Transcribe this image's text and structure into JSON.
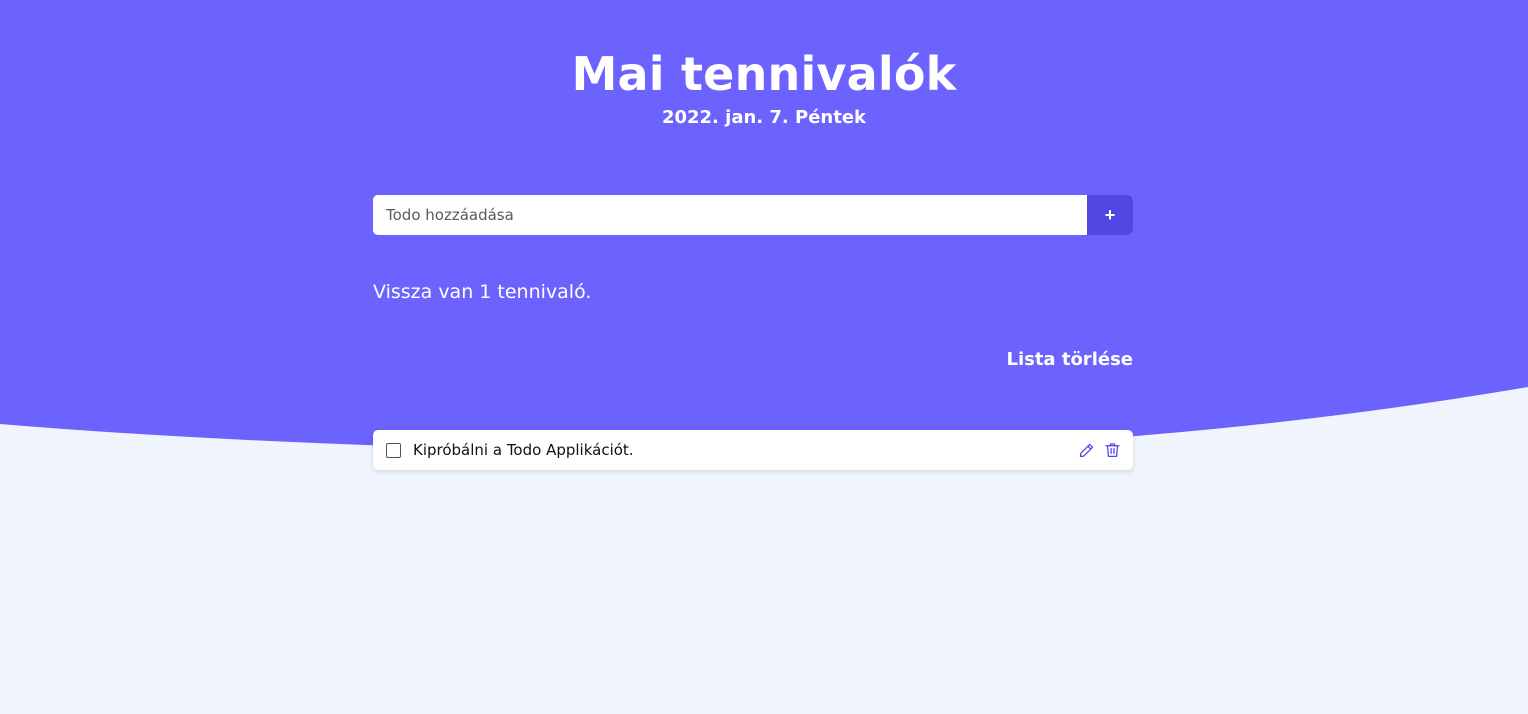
{
  "header": {
    "title": "Mai tennivalók",
    "date": "2022. jan. 7. Péntek"
  },
  "add_form": {
    "placeholder": "Todo hozzáadása",
    "value": "",
    "button_label": "+"
  },
  "status": {
    "remaining_text": "Vissza van 1 tennivaló."
  },
  "actions": {
    "clear_label": "Lista törlése"
  },
  "todos": [
    {
      "text": "Kipróbálni a Todo Applikációt.",
      "done": false
    }
  ],
  "icons": {
    "edit": "pencil-icon",
    "delete": "trash-icon"
  },
  "colors": {
    "hero": "#6c63ff",
    "accent": "#5147e3",
    "background": "#f0f5fd"
  }
}
